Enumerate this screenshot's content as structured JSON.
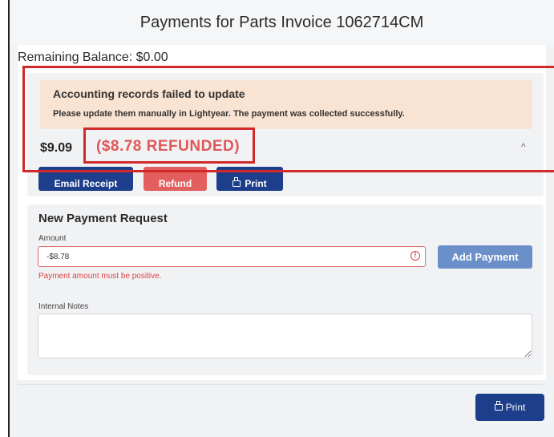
{
  "modal": {
    "title": "Payments for Parts Invoice 1062714CM",
    "remaining_balance": "Remaining Balance: $0.00"
  },
  "payment": {
    "alert_title": "Accounting records failed to update",
    "alert_message": "Please update them manually in Lightyear. The payment was collected successfully.",
    "amount": "$9.09",
    "refunded": "($8.78 REFUNDED)",
    "chevron": "^",
    "buttons": {
      "email_receipt": "Email Receipt",
      "refund": "Refund",
      "print": "Print"
    }
  },
  "new_payment": {
    "title": "New Payment Request",
    "amount_label": "Amount",
    "amount_value": "-$8.78",
    "error": "Payment amount must be positive.",
    "add_payment": "Add Payment",
    "notes_label": "Internal Notes"
  },
  "footer": {
    "print": "Print"
  },
  "colors": {
    "primary": "#1d3e8a",
    "danger": "#e35f5f",
    "alert_bg": "#f9e3d2",
    "error_text": "#d84444",
    "highlight_box": "#d22a2a"
  },
  "icons": {
    "print": "printer-icon",
    "warning": "exclamation-circle-icon",
    "collapse": "chevron-up-icon"
  }
}
